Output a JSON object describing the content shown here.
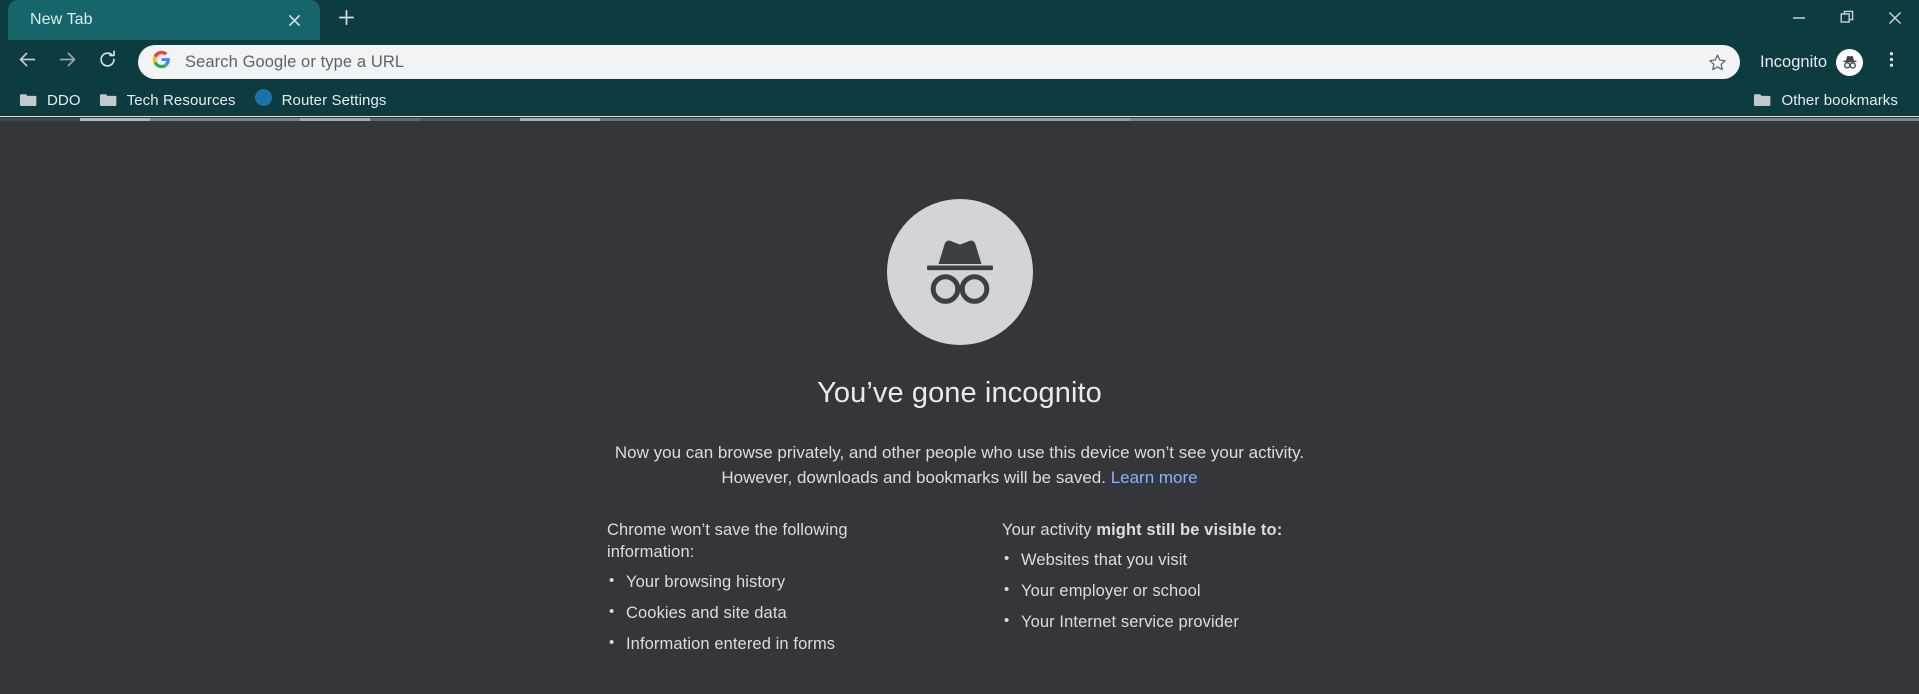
{
  "window": {
    "minimize_icon": "minimize-icon",
    "restore_icon": "restore-icon",
    "close_icon": "close-icon"
  },
  "tabstrip": {
    "tabs": [
      {
        "title": "New Tab",
        "close_icon": "close-icon"
      }
    ],
    "new_tab_icon": "plus-icon"
  },
  "toolbar": {
    "back_icon": "arrow-back-icon",
    "forward_icon": "arrow-forward-icon",
    "reload_icon": "reload-icon",
    "search_engine_icon": "google-g-icon",
    "omnibox_value": "",
    "omnibox_placeholder": "Search Google or type a URL",
    "star_icon": "star-outline-icon",
    "profile_label": "Incognito",
    "profile_icon": "incognito-avatar-icon",
    "menu_icon": "three-dot-menu-icon"
  },
  "bookmarks": {
    "items": [
      {
        "label": "DDO",
        "icon": "folder-icon"
      },
      {
        "label": "Tech Resources",
        "icon": "folder-icon"
      },
      {
        "label": "Router Settings",
        "icon": "globe-icon"
      }
    ],
    "other": {
      "label": "Other bookmarks",
      "icon": "folder-icon"
    }
  },
  "page": {
    "illustration_icon": "incognito-hat-glasses-icon",
    "heading": "You’ve gone incognito",
    "intro_line1": "Now you can browse privately, and other people who use this device won’t see your activity.",
    "intro_line2": "However, downloads and bookmarks will be saved.",
    "learn_more": "Learn more",
    "columns": [
      {
        "title": "Chrome won’t save the following information:",
        "title_prefix": "Chrome won’t save the following information:",
        "title_bold": "",
        "items": [
          "Your browsing history",
          "Cookies and site data",
          "Information entered in forms"
        ]
      },
      {
        "title": "Your activity might still be visible to:",
        "title_prefix": "Your activity ",
        "title_bold": "might still be visible to:",
        "items": [
          "Websites that you visit",
          "Your employer or school",
          "Your Internet service provider"
        ]
      }
    ]
  },
  "colors": {
    "chrome_frame": "#0d3c40",
    "tab_active": "#15656b",
    "page_bg": "#35363a",
    "link": "#8ab4f8",
    "omnibox_bg": "#f1f3f4"
  }
}
